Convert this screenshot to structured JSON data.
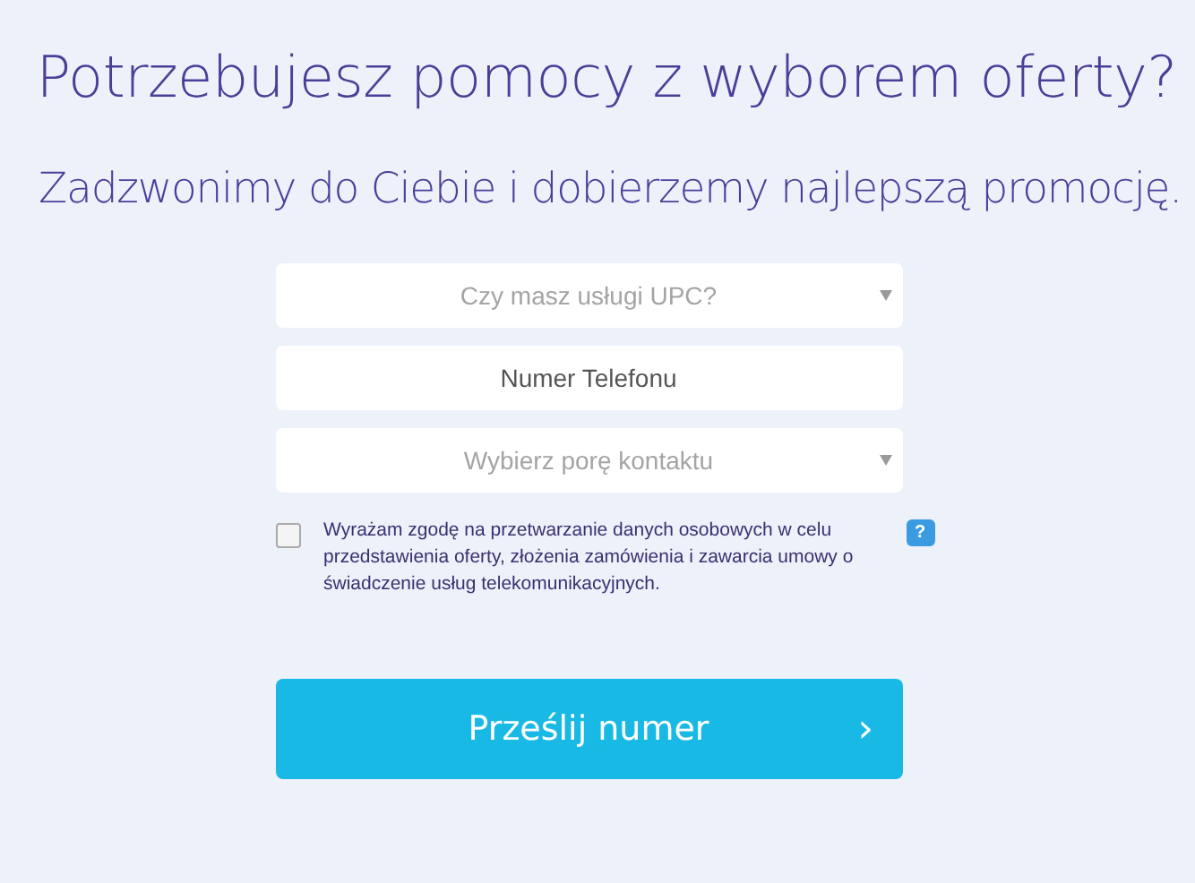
{
  "heading": "Potrzebujesz pomocy z wyborem oferty?",
  "subheading": "Zadzwonimy do Ciebie i dobierzemy najlepszą promocję.",
  "fields": [
    {
      "kind": "select",
      "placeholder": "Czy masz usługi UPC?"
    },
    {
      "kind": "input",
      "placeholder": "Numer Telefonu"
    },
    {
      "kind": "select",
      "placeholder": "Wybierz porę kontaktu"
    }
  ],
  "consent": {
    "checked": false,
    "text": "Wyrażam zgodę na przetwarzanie danych osobowych w celu przedstawienia oferty, złożenia zamówienia i zawarcia umowy o świadczenie usług telekomunikacyjnych.",
    "help": "?"
  },
  "submit": {
    "label": "Prześlij numer",
    "chevron": "›"
  }
}
